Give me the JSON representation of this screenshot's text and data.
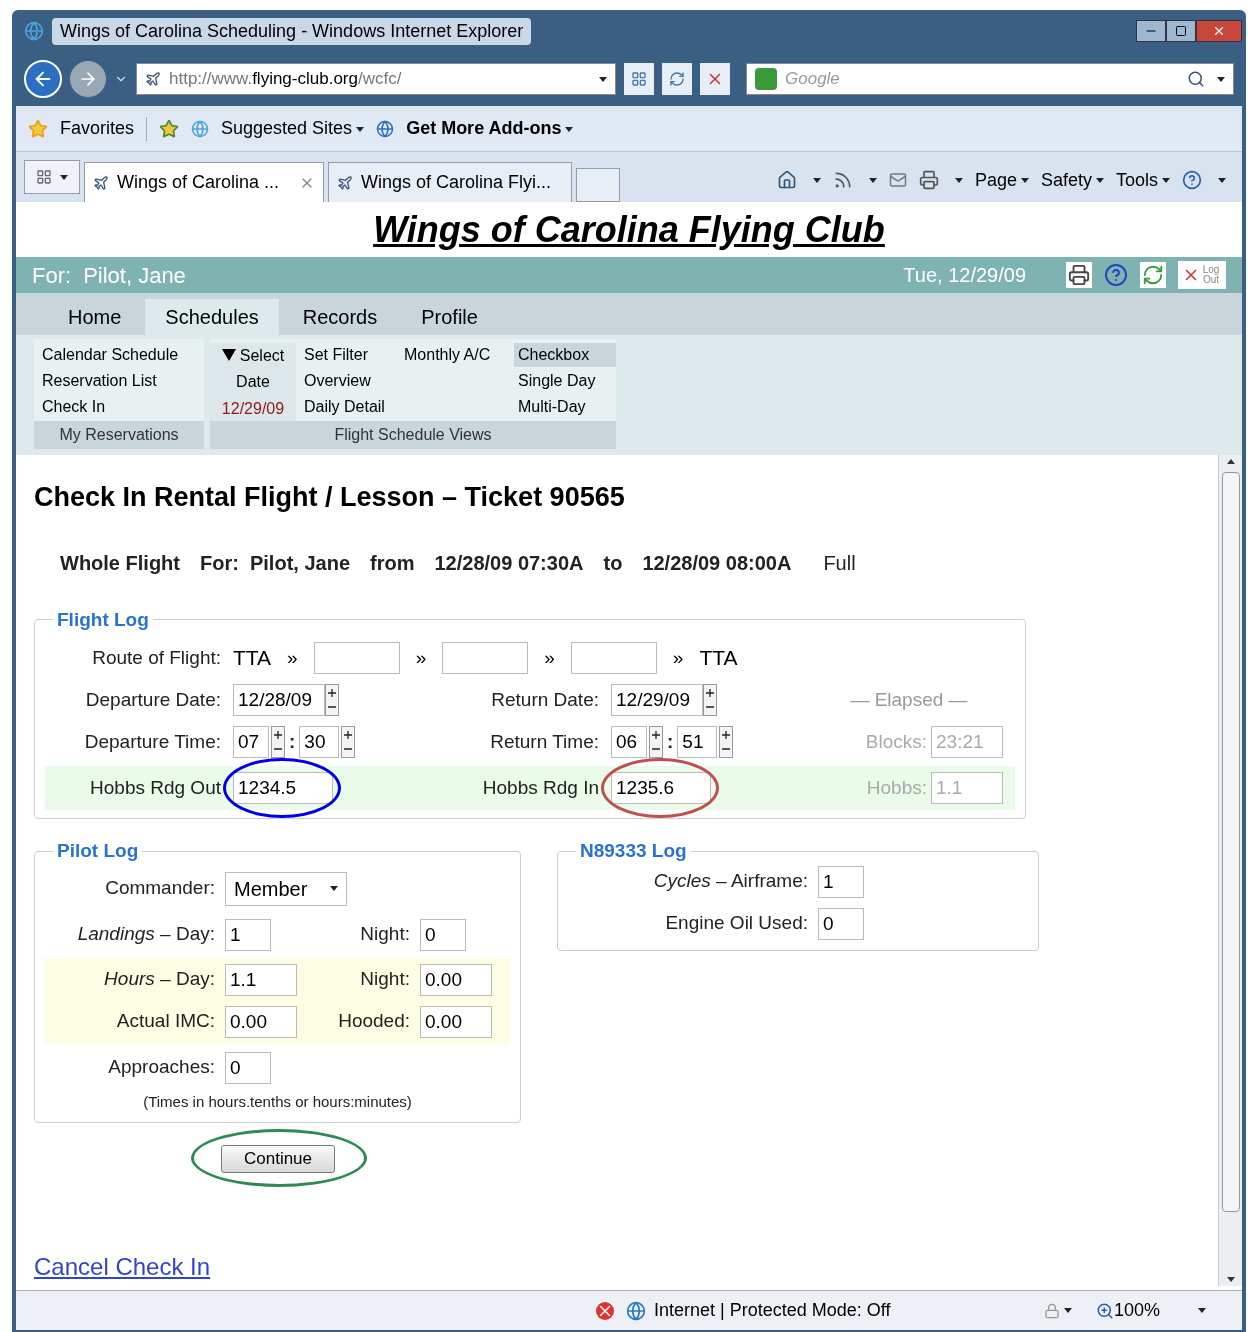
{
  "window": {
    "title": "Wings of Carolina Scheduling - Windows Internet Explorer"
  },
  "address_bar": {
    "prefix": "http://www.",
    "domain": "flying-club.org",
    "path": "/wcfc/"
  },
  "search": {
    "placeholder": "Google"
  },
  "favorites_bar": {
    "favorites": "Favorites",
    "suggested_sites": "Suggested Sites",
    "addons": "Get More Add-ons"
  },
  "browser_tabs": [
    {
      "label": "Wings of Carolina ...",
      "selected": true
    },
    {
      "label": "Wings of Carolina Flyi...",
      "selected": false
    }
  ],
  "command_bar": [
    "Page",
    "Safety",
    "Tools"
  ],
  "site": {
    "title": "Wings of Carolina Flying Club",
    "for_label": "For:",
    "user": "Pilot, Jane",
    "date": "Tue, 12/29/09",
    "logout": "Log Out"
  },
  "nav_tabs": [
    {
      "label": "Home",
      "selected": false
    },
    {
      "label": "Schedules",
      "selected": true
    },
    {
      "label": "Records",
      "selected": false
    },
    {
      "label": "Profile",
      "selected": false
    }
  ],
  "submenu": {
    "my_items": [
      "Calendar Schedule",
      "Reservation List",
      "Check In"
    ],
    "my_footer": "My Reservations",
    "select_label": "Select",
    "date_label": "Date",
    "date": "12/29/09",
    "filters": [
      "Set Filter",
      "Overview",
      "Daily Detail"
    ],
    "monthly": "Monthly A/C",
    "views": [
      {
        "label": "Checkbox",
        "selected": true
      },
      {
        "label": "Single Day",
        "selected": false
      },
      {
        "label": "Multi-Day",
        "selected": false
      }
    ],
    "views_footer": "Flight Schedule Views"
  },
  "page": {
    "heading": "Check In Rental Flight / Lesson – Ticket 90565",
    "summary": [
      "Whole Flight",
      "For:  Pilot, Jane",
      "from",
      "12/28/09 07:30A",
      "to",
      "12/28/09 08:00A"
    ],
    "status": "Full"
  },
  "flight_log": {
    "title": "Flight Log",
    "route_label": "Route of Flight:",
    "route": [
      {
        "kind": "text",
        "text": "TTA"
      },
      {
        "kind": "sep",
        "text": "»"
      },
      {
        "kind": "field"
      },
      {
        "kind": "sep",
        "text": "»"
      },
      {
        "kind": "field"
      },
      {
        "kind": "sep",
        "text": "»"
      },
      {
        "kind": "field"
      },
      {
        "kind": "sep",
        "text": "»"
      },
      {
        "kind": "text",
        "text": "TTA"
      }
    ],
    "departure_date_label": "Departure Date:",
    "departure_date": "12/28/09",
    "return_date_label": "Return Date:",
    "return_date": "12/29/09",
    "departure_time_label": "Departure Time:",
    "departure_hour": "07",
    "departure_minute": "30",
    "return_time_label": "Return Time:",
    "return_hour": "06",
    "return_minute": "51",
    "time_separator": ":",
    "elapsed_label": "— Elapsed —",
    "blocks_label": "Blocks:",
    "blocks": "23:21",
    "hobbs_out_label": "Hobbs Rdg Out",
    "hobbs_out": "1234.5",
    "hobbs_in_label": "Hobbs Rdg In",
    "hobbs_in": "1235.6",
    "hobbs_label": "Hobbs:",
    "hobbs": "1.1"
  },
  "pilot_log": {
    "title": "Pilot Log",
    "commander_label": "Commander:",
    "commander": "Member",
    "landings_day_label": "*Landings* – Day:",
    "landings_day": "1",
    "landings_night_label": "Night:",
    "landings_night": "0",
    "hours_day_label": "*Hours* – Day:",
    "hours_day": "1.1",
    "hours_night_label": "Night:",
    "hours_night": "0.00",
    "imc_label": "Actual IMC:",
    "imc": "0.00",
    "hooded_label": "Hooded:",
    "hooded": "0.00",
    "approaches_label": "Approaches:",
    "approaches": "0",
    "note": "(Times in hours.tenths or hours:minutes)"
  },
  "aircraft_log": {
    "title": "N89333 Log",
    "cycles_label": "*Cycles* – Airframe:",
    "cycles": "1",
    "oil_label": "Engine Oil Used:",
    "oil": "0"
  },
  "continue_button": {
    "label": "Continue"
  },
  "annotations": [
    {
      "kind": "hobbs_out",
      "color": "#0000e6"
    },
    {
      "kind": "hobbs_in",
      "color": "#c0504d"
    },
    {
      "kind": "continue",
      "color": "#2e8b57"
    }
  ],
  "cancel_link": "Cancel Check In",
  "status_bar": {
    "zone": "Internet | Protected Mode: Off",
    "zoom": "100%"
  }
}
